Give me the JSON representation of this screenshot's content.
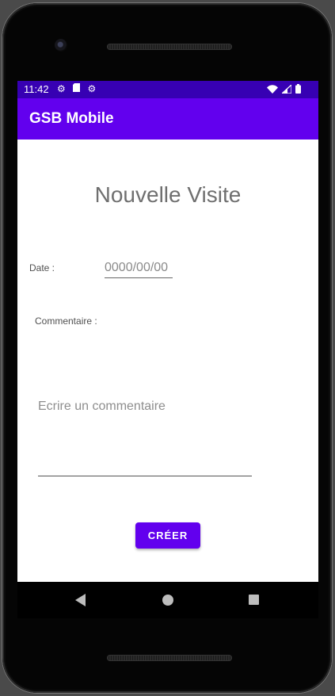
{
  "status_bar": {
    "time": "11:42",
    "left_icons": [
      "gear-icon",
      "sd-card-icon",
      "settings-icon"
    ],
    "right_icons": [
      "wifi-icon",
      "signal-icon",
      "battery-icon"
    ]
  },
  "app_bar": {
    "title": "GSB Mobile",
    "color": "#6200ee",
    "status_color": "#3700b3"
  },
  "form": {
    "title": "Nouvelle Visite",
    "date_label": "Date :",
    "date_placeholder": "0000/00/00",
    "comment_label": "Commentaire :",
    "comment_placeholder": "Ecrire un commentaire",
    "submit_label": "CRÉER"
  },
  "nav_bar": {
    "icons": [
      "back-icon",
      "home-icon",
      "recents-icon"
    ]
  }
}
